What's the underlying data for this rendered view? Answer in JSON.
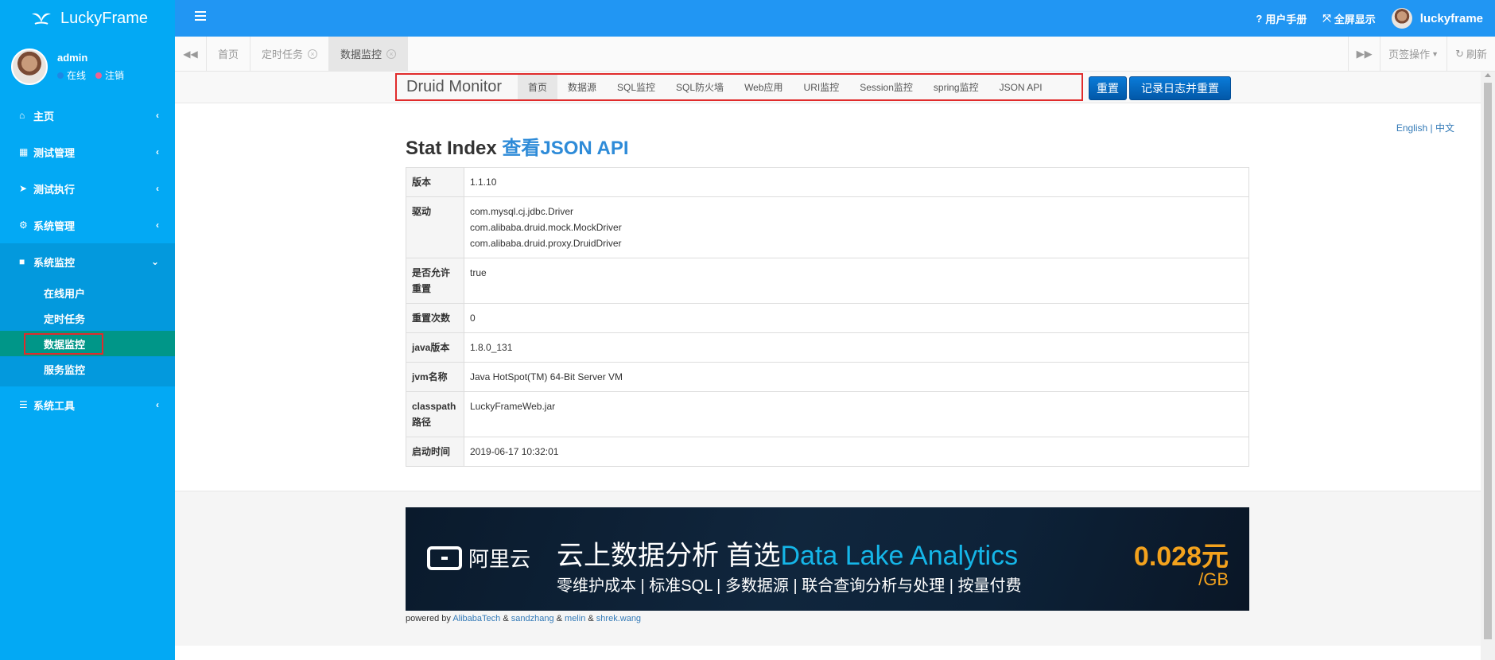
{
  "app": {
    "brand": "LuckyFrame",
    "user": {
      "name": "admin",
      "online": "在线",
      "logout": "注销"
    },
    "colors": {
      "sidebar": "#03a9f4",
      "topbar": "#2196f3",
      "active_sub": "#009688",
      "highlight": "#e02b2b"
    }
  },
  "sidebar": {
    "items": [
      {
        "label": "主页",
        "icon": "home-icon"
      },
      {
        "label": "测试管理",
        "icon": "grid-icon"
      },
      {
        "label": "测试执行",
        "icon": "paper-plane-icon"
      },
      {
        "label": "系统管理",
        "icon": "gear-icon"
      },
      {
        "label": "系统监控",
        "icon": "video-camera-icon"
      },
      {
        "label": "系统工具",
        "icon": "bars-icon"
      }
    ],
    "submenu": [
      "在线用户",
      "定时任务",
      "数据监控",
      "服务监控"
    ]
  },
  "topbar": {
    "manual": "用户手册",
    "fullscreen": "全屏显示",
    "username": "luckyframe"
  },
  "tabs": {
    "items": [
      "首页",
      "定时任务",
      "数据监控"
    ],
    "page_ops": "页签操作",
    "refresh": "刷新"
  },
  "druid": {
    "brand": "Druid Monitor",
    "nav": [
      "首页",
      "数据源",
      "SQL监控",
      "SQL防火墙",
      "Web应用",
      "URI监控",
      "Session监控",
      "spring监控",
      "JSON API"
    ],
    "reset": "重置",
    "log_reset": "记录日志并重置",
    "lang_en": "English",
    "lang_sep": "|",
    "lang_zh": "中文",
    "title": "Stat Index",
    "title_link": "查看JSON API",
    "rows": [
      {
        "key": "版本",
        "value": [
          "1.1.10"
        ]
      },
      {
        "key": "驱动",
        "value": [
          "com.mysql.cj.jdbc.Driver",
          "com.alibaba.druid.mock.MockDriver",
          "com.alibaba.druid.proxy.DruidDriver"
        ]
      },
      {
        "key": "是否允许重置",
        "value": [
          "true"
        ]
      },
      {
        "key": "重置次数",
        "value": [
          "0"
        ]
      },
      {
        "key": "java版本",
        "value": [
          "1.8.0_131"
        ]
      },
      {
        "key": "jvm名称",
        "value": [
          "Java HotSpot(TM) 64-Bit Server VM"
        ]
      },
      {
        "key": "classpath路径",
        "value": [
          "LuckyFrameWeb.jar"
        ]
      },
      {
        "key": "启动时间",
        "value": [
          "2019-06-17 10:32:01"
        ]
      }
    ],
    "banner": {
      "brand": "阿里云",
      "headline_cn": "云上数据分析 首选",
      "headline_en": "Data Lake Analytics",
      "sub": "零维护成本 | 标准SQL | 多数据源 | 联合查询分析与处理 | 按量付费",
      "price": "0.028元",
      "unit": "/GB"
    },
    "powered": {
      "prefix": "powered by",
      "links": [
        "AlibabaTech",
        "sandzhang",
        "melin",
        "shrek.wang"
      ],
      "sep": "&"
    }
  }
}
